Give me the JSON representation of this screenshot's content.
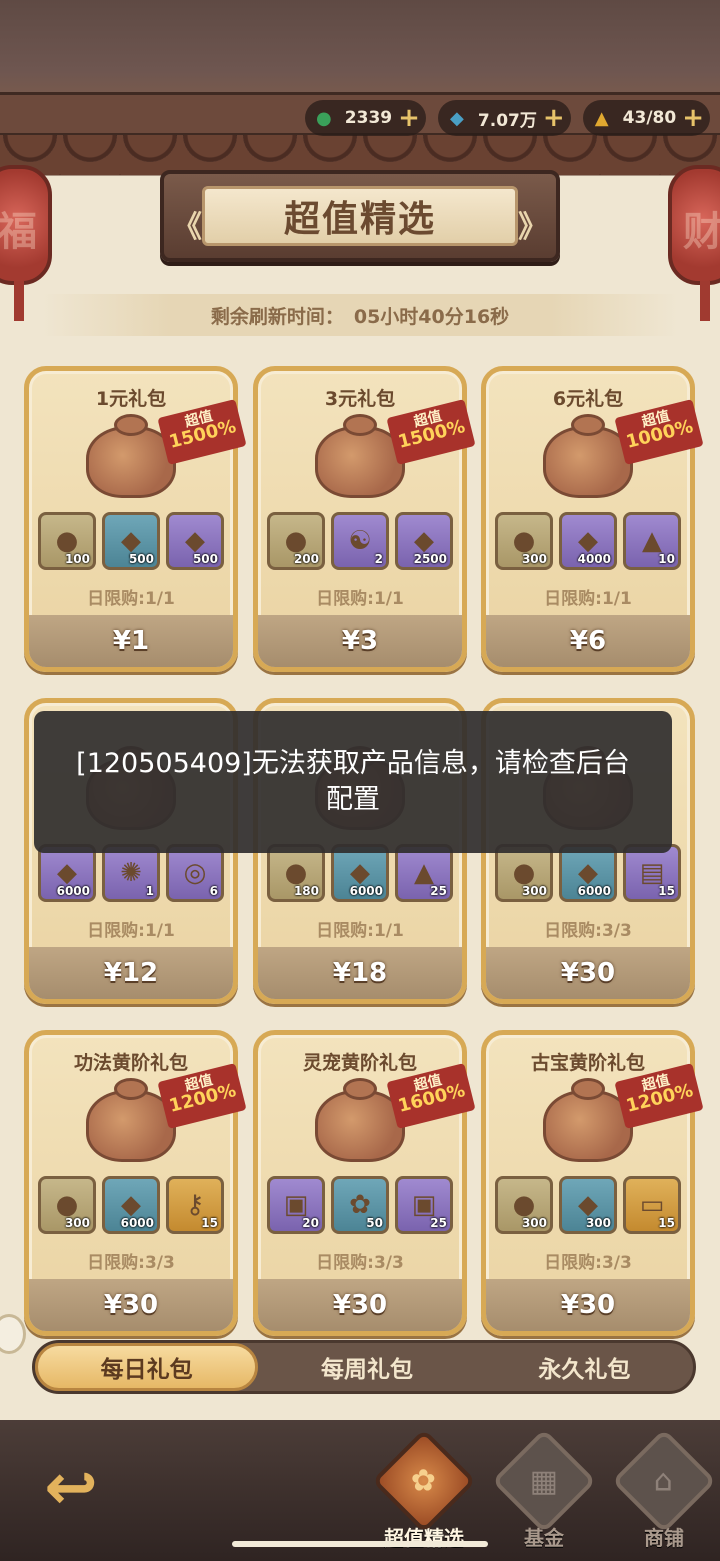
{
  "currency": [
    {
      "icon": "jade-icon",
      "value": "2339",
      "color": "#3aa05a",
      "glyph": "●"
    },
    {
      "icon": "crystal-icon",
      "value": "7.07万",
      "color": "#4a9fc4",
      "glyph": "◆"
    },
    {
      "icon": "flame-icon",
      "value": "43/80",
      "color": "#e0a830",
      "glyph": "▲"
    }
  ],
  "currency_plus": "+",
  "lanterns": {
    "left": "福",
    "right": "财"
  },
  "title": "超值精选",
  "title_deco_left": "《",
  "title_deco_right": "》",
  "refresh": {
    "label": "剩余刷新时间：",
    "value": "05小时40分16秒"
  },
  "cards": [
    {
      "name": "1元礼包",
      "badge_a": "超值",
      "badge_b": "1500%",
      "items": [
        {
          "kind": "green",
          "glyph": "●",
          "count": "100"
        },
        {
          "kind": "blue",
          "glyph": "◆",
          "count": "500"
        },
        {
          "kind": "purple",
          "glyph": "◆",
          "count": "500"
        }
      ],
      "limit": "日限购:1/1",
      "price": "¥1"
    },
    {
      "name": "3元礼包",
      "badge_a": "超值",
      "badge_b": "1500%",
      "items": [
        {
          "kind": "green",
          "glyph": "●",
          "count": "200"
        },
        {
          "kind": "purple",
          "glyph": "☯",
          "count": "2"
        },
        {
          "kind": "purple",
          "glyph": "◆",
          "count": "2500"
        }
      ],
      "limit": "日限购:1/1",
      "price": "¥3"
    },
    {
      "name": "6元礼包",
      "badge_a": "超值",
      "badge_b": "1000%",
      "items": [
        {
          "kind": "green",
          "glyph": "●",
          "count": "300"
        },
        {
          "kind": "purple",
          "glyph": "◆",
          "count": "4000"
        },
        {
          "kind": "purple",
          "glyph": "▲",
          "count": "10"
        }
      ],
      "limit": "日限购:1/1",
      "price": "¥6"
    },
    {
      "name": "",
      "badge_a": "",
      "badge_b": "",
      "items": [
        {
          "kind": "purple",
          "glyph": "◆",
          "count": "6000"
        },
        {
          "kind": "purple",
          "glyph": "✺",
          "count": "1"
        },
        {
          "kind": "purple",
          "glyph": "◎",
          "count": "6"
        }
      ],
      "limit": "日限购:1/1",
      "price": "¥12"
    },
    {
      "name": "",
      "badge_a": "",
      "badge_b": "",
      "items": [
        {
          "kind": "green",
          "glyph": "●",
          "count": "180"
        },
        {
          "kind": "blue",
          "glyph": "◆",
          "count": "6000"
        },
        {
          "kind": "purple",
          "glyph": "▲",
          "count": "25"
        }
      ],
      "limit": "日限购:1/1",
      "price": "¥18"
    },
    {
      "name": "",
      "badge_a": "",
      "badge_b": "",
      "items": [
        {
          "kind": "green",
          "glyph": "●",
          "count": "300"
        },
        {
          "kind": "blue",
          "glyph": "◆",
          "count": "6000"
        },
        {
          "kind": "purple",
          "glyph": "▤",
          "count": "15"
        }
      ],
      "limit": "日限购:3/3",
      "price": "¥30"
    },
    {
      "name": "功法黄阶礼包",
      "badge_a": "超值",
      "badge_b": "1200%",
      "items": [
        {
          "kind": "green",
          "glyph": "●",
          "count": "300"
        },
        {
          "kind": "blue",
          "glyph": "◆",
          "count": "6000"
        },
        {
          "kind": "orange",
          "glyph": "⚷",
          "count": "15"
        }
      ],
      "limit": "日限购:3/3",
      "price": "¥30"
    },
    {
      "name": "灵宠黄阶礼包",
      "badge_a": "超值",
      "badge_b": "1600%",
      "items": [
        {
          "kind": "purple",
          "glyph": "▣",
          "count": "20"
        },
        {
          "kind": "blue",
          "glyph": "✿",
          "count": "50"
        },
        {
          "kind": "purple",
          "glyph": "▣",
          "count": "25"
        }
      ],
      "limit": "日限购:3/3",
      "price": "¥30"
    },
    {
      "name": "古宝黄阶礼包",
      "badge_a": "超值",
      "badge_b": "1200%",
      "items": [
        {
          "kind": "green",
          "glyph": "●",
          "count": "300"
        },
        {
          "kind": "blue",
          "glyph": "◆",
          "count": "300"
        },
        {
          "kind": "orange",
          "glyph": "▭",
          "count": "15"
        }
      ],
      "limit": "日限购:3/3",
      "price": "¥30"
    }
  ],
  "toast": "[120505409]无法获取产品信息，请检查后台配置",
  "tabs": [
    "每日礼包",
    "每周礼包",
    "永久礼包"
  ],
  "nav": [
    {
      "label": "超值精选",
      "glyph": "✿"
    },
    {
      "label": "基金",
      "glyph": "▦"
    },
    {
      "label": "商铺",
      "glyph": "⌂"
    }
  ],
  "back_glyph": "↩",
  "colors": {
    "accent": "#d7a955",
    "badge": "#a8322b",
    "toast_bg": "#302e2e"
  }
}
